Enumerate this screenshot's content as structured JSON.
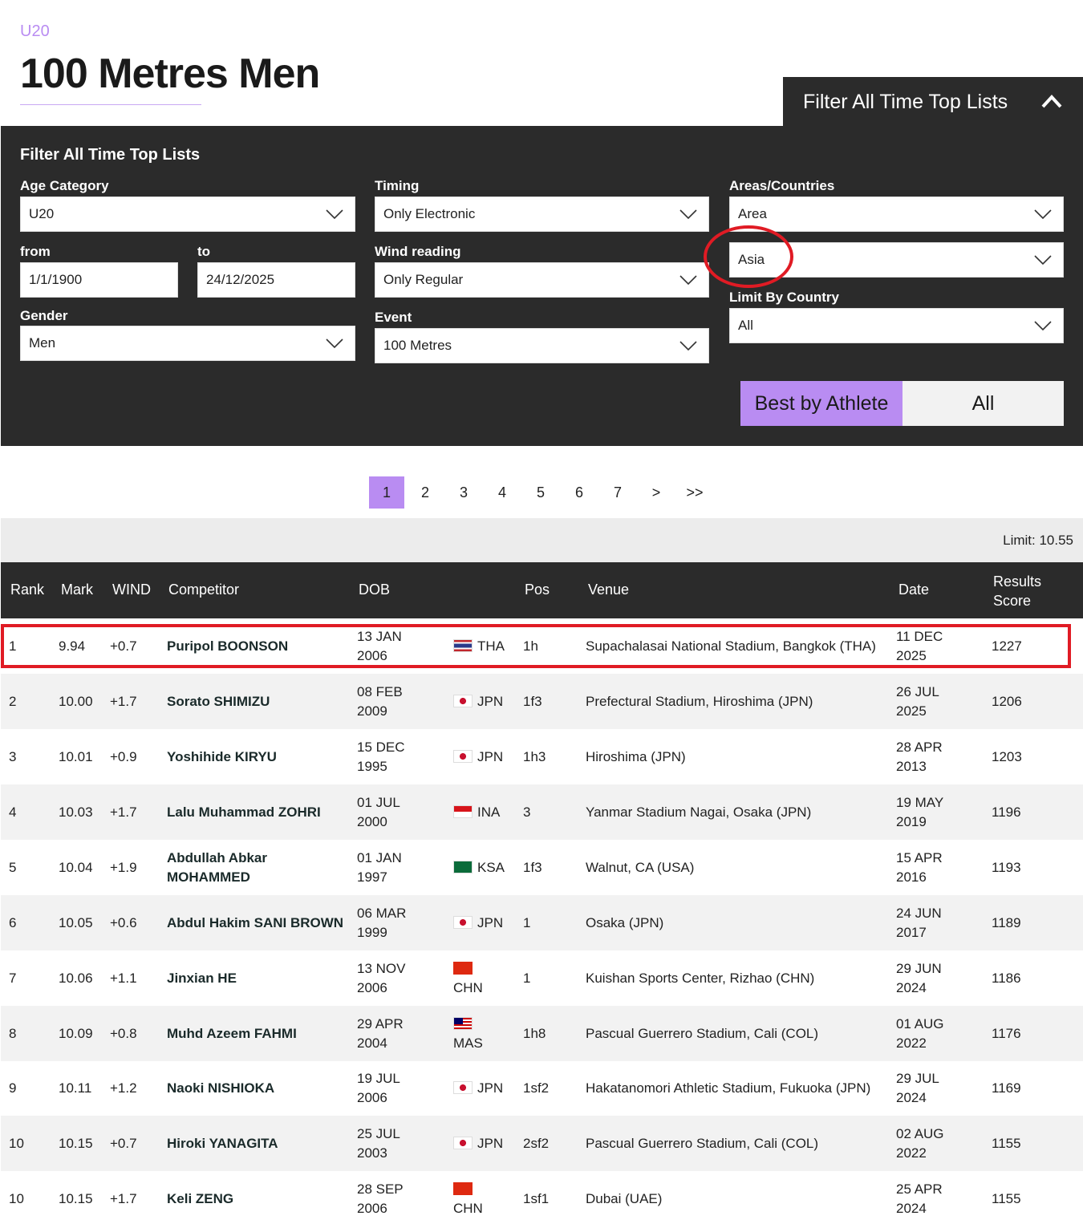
{
  "header": {
    "eyebrow": "U20",
    "title": "100 Metres Men"
  },
  "filter_tab": {
    "label": "Filter All Time Top Lists",
    "icon": "chevron-up-icon"
  },
  "filters": {
    "heading": "Filter All Time Top Lists",
    "age_category": {
      "label": "Age Category",
      "value": "U20"
    },
    "from": {
      "label": "from",
      "value": "1/1/1900"
    },
    "to": {
      "label": "to",
      "value": "24/12/2025"
    },
    "gender": {
      "label": "Gender",
      "value": "Men"
    },
    "timing": {
      "label": "Timing",
      "value": "Only Electronic"
    },
    "wind": {
      "label": "Wind reading",
      "value": "Only Regular"
    },
    "event": {
      "label": "Event",
      "value": "100 Metres"
    },
    "areas": {
      "label": "Areas/Countries",
      "value": "Area"
    },
    "area_select": {
      "value": "Asia"
    },
    "limit_country": {
      "label": "Limit By Country",
      "value": "All"
    },
    "toggle": {
      "active": "Best by Athlete",
      "other": "All"
    }
  },
  "pagination": [
    "1",
    "2",
    "3",
    "4",
    "5",
    "6",
    "7",
    ">",
    ">>"
  ],
  "limit_text": "Limit: 10.55",
  "table": {
    "headers": {
      "rank": "Rank",
      "mark": "Mark",
      "wind": "WIND",
      "competitor": "Competitor",
      "dob": "DOB",
      "pos": "Pos",
      "venue": "Venue",
      "date": "Date",
      "score_line1": "Results",
      "score_line2": "Score"
    },
    "rows": [
      {
        "rank": "1",
        "mark": "9.94",
        "wind": "+0.7",
        "name": "Puripol BOONSON",
        "dob1": "13 JAN",
        "dob2": "2006",
        "nat": "THA",
        "pos": "1h",
        "venue": "Supachalasai National Stadium, Bangkok (THA)",
        "date1": "11 DEC",
        "date2": "2025",
        "score": "1227"
      },
      {
        "rank": "2",
        "mark": "10.00",
        "wind": "+1.7",
        "name": "Sorato SHIMIZU",
        "dob1": "08 FEB",
        "dob2": "2009",
        "nat": "JPN",
        "pos": "1f3",
        "venue": "Prefectural Stadium, Hiroshima (JPN)",
        "date1": "26 JUL",
        "date2": "2025",
        "score": "1206"
      },
      {
        "rank": "3",
        "mark": "10.01",
        "wind": "+0.9",
        "name": "Yoshihide KIRYU",
        "dob1": "15 DEC",
        "dob2": "1995",
        "nat": "JPN",
        "pos": "1h3",
        "venue": "Hiroshima (JPN)",
        "date1": "28 APR",
        "date2": "2013",
        "score": "1203"
      },
      {
        "rank": "4",
        "mark": "10.03",
        "wind": "+1.7",
        "name": "Lalu Muhammad ZOHRI",
        "dob1": "01 JUL",
        "dob2": "2000",
        "nat": "INA",
        "pos": "3",
        "venue": "Yanmar Stadium Nagai, Osaka (JPN)",
        "date1": "19 MAY",
        "date2": "2019",
        "score": "1196"
      },
      {
        "rank": "5",
        "mark": "10.04",
        "wind": "+1.9",
        "name1": "Abdullah Abkar",
        "name2": "MOHAMMED",
        "dob1": "01 JAN",
        "dob2": "1997",
        "nat": "KSA",
        "pos": "1f3",
        "venue": "Walnut, CA (USA)",
        "date1": "15 APR",
        "date2": "2016",
        "score": "1193"
      },
      {
        "rank": "6",
        "mark": "10.05",
        "wind": "+0.6",
        "name": "Abdul Hakim SANI BROWN",
        "dob1": "06 MAR",
        "dob2": "1999",
        "nat": "JPN",
        "pos": "1",
        "venue": "Osaka (JPN)",
        "date1": "24 JUN",
        "date2": "2017",
        "score": "1189"
      },
      {
        "rank": "7",
        "mark": "10.06",
        "wind": "+1.1",
        "name": "Jinxian HE",
        "dob1": "13 NOV",
        "dob2": "2006",
        "nat": "CHN",
        "pos": "1",
        "venue": "Kuishan Sports Center, Rizhao (CHN)",
        "date1": "29 JUN",
        "date2": "2024",
        "score": "1186"
      },
      {
        "rank": "8",
        "mark": "10.09",
        "wind": "+0.8",
        "name": "Muhd Azeem FAHMI",
        "dob1": "29 APR",
        "dob2": "2004",
        "nat": "MAS",
        "pos": "1h8",
        "venue": "Pascual Guerrero Stadium, Cali (COL)",
        "date1": "01 AUG",
        "date2": "2022",
        "score": "1176"
      },
      {
        "rank": "9",
        "mark": "10.11",
        "wind": "+1.2",
        "name": "Naoki NISHIOKA",
        "dob1": "19 JUL",
        "dob2": "2006",
        "nat": "JPN",
        "pos": "1sf2",
        "venue": "Hakatanomori Athletic Stadium, Fukuoka (JPN)",
        "date1": "29 JUL",
        "date2": "2024",
        "score": "1169"
      },
      {
        "rank": "10",
        "mark": "10.15",
        "wind": "+0.7",
        "name": "Hiroki YANAGITA",
        "dob1": "25 JUL",
        "dob2": "2003",
        "nat": "JPN",
        "pos": "2sf2",
        "venue": "Pascual Guerrero Stadium, Cali (COL)",
        "date1": "02 AUG",
        "date2": "2022",
        "score": "1155"
      },
      {
        "rank": "10",
        "mark": "10.15",
        "wind": "+1.7",
        "name": "Keli ZENG",
        "dob1": "28 SEP",
        "dob2": "2006",
        "nat": "CHN",
        "pos": "1sf1",
        "venue": "Dubai (UAE)",
        "date1": "25 APR",
        "date2": "2024",
        "score": "1155"
      }
    ]
  }
}
